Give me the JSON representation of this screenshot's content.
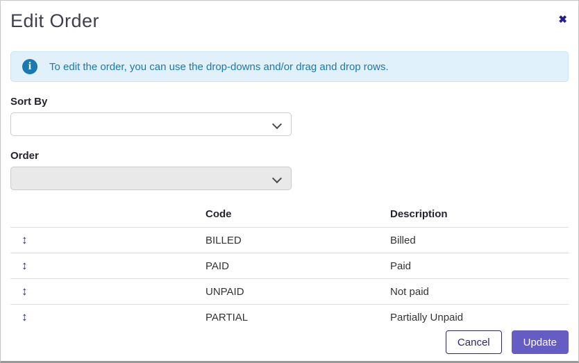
{
  "dialog": {
    "title": "Edit Order",
    "close_icon": "✖"
  },
  "info": {
    "icon_glyph": "i",
    "message": "To edit the order, you can use the drop-downs and/or drag and drop rows."
  },
  "form": {
    "sort_by": {
      "label": "Sort By",
      "value": ""
    },
    "order": {
      "label": "Order",
      "value": "",
      "disabled": true
    }
  },
  "table": {
    "drag_icon": "↕",
    "columns": [
      "",
      "Code",
      "Description"
    ],
    "rows": [
      {
        "code": "BILLED",
        "description": "Billed"
      },
      {
        "code": "PAID",
        "description": "Paid"
      },
      {
        "code": "UNPAID",
        "description": "Not paid"
      },
      {
        "code": "PARTIAL",
        "description": "Partially Unpaid"
      }
    ]
  },
  "footer": {
    "cancel_label": "Cancel",
    "update_label": "Update"
  },
  "colors": {
    "accent_purple": "#655cc4",
    "navy": "#2d2477",
    "info_text_blue": "#1b76b2",
    "info_bg": "#e1f1fb",
    "drag_icon_blue": "#2323ad",
    "close_icon_navy": "#241f8c"
  }
}
